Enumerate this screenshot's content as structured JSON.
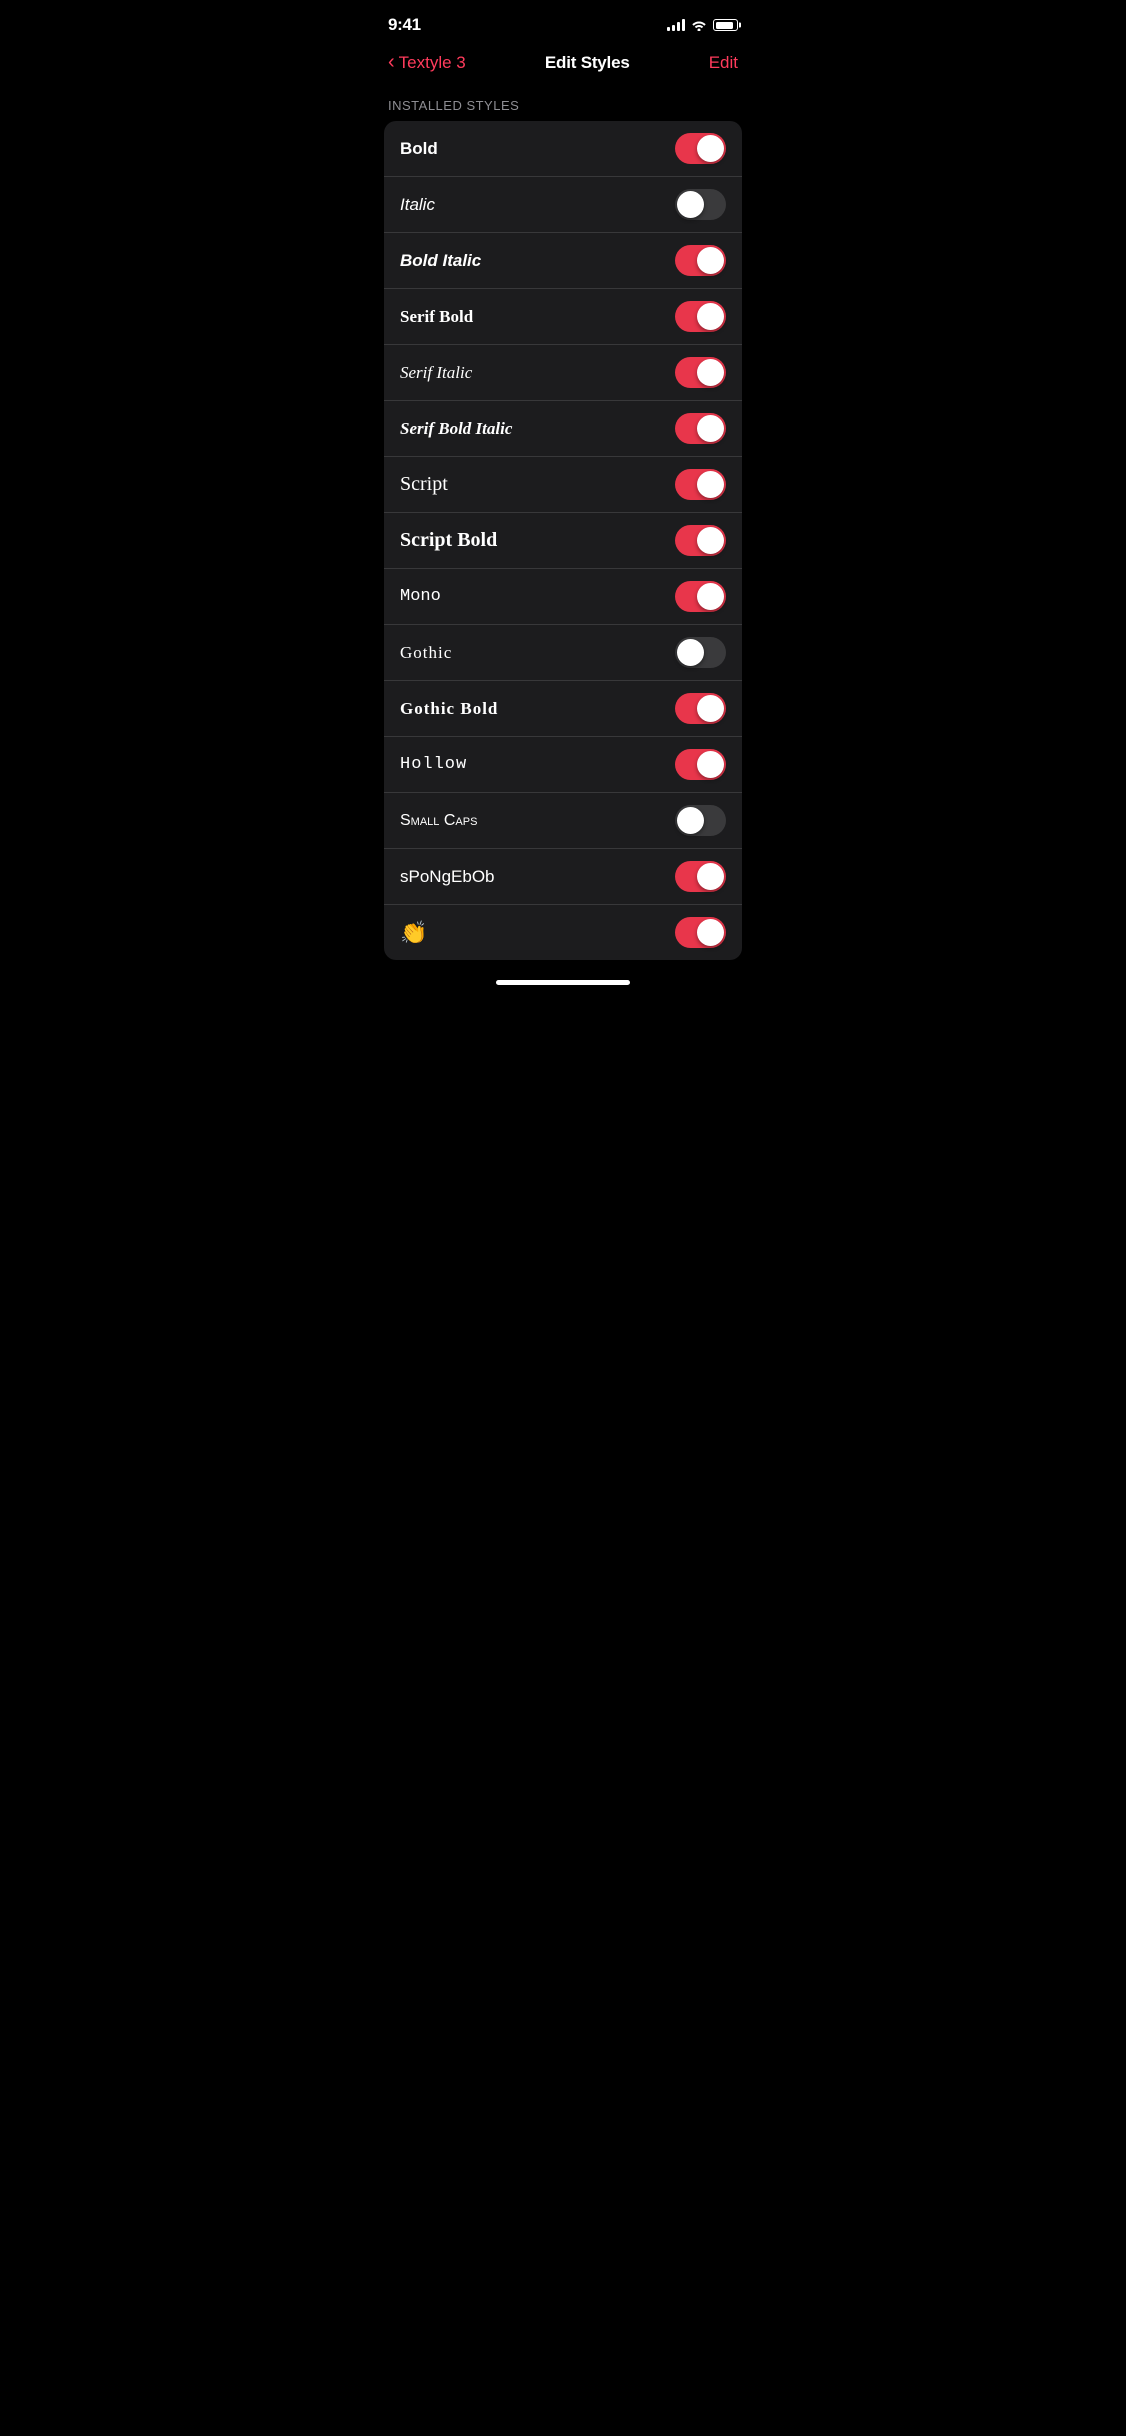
{
  "statusBar": {
    "time": "9:41",
    "signal": 4,
    "wifi": true,
    "battery": 85
  },
  "nav": {
    "backLabel": "Textyle 3",
    "title": "Edit Styles",
    "editLabel": "Edit"
  },
  "sectionHeader": "INSTALLED STYLES",
  "styles": [
    {
      "id": "bold",
      "label": "Bold",
      "fontClass": "font-bold",
      "enabled": true
    },
    {
      "id": "italic",
      "label": "Italic",
      "fontClass": "font-italic",
      "enabled": false
    },
    {
      "id": "bold-italic",
      "label": "Bold Italic",
      "fontClass": "font-bold-italic",
      "enabled": true
    },
    {
      "id": "serif-bold",
      "label": "Serif Bold",
      "fontClass": "font-serif",
      "enabled": true
    },
    {
      "id": "serif-italic",
      "label": "Serif Italic",
      "fontClass": "font-serif-italic",
      "enabled": true
    },
    {
      "id": "serif-bold-italic",
      "label": "Serif Bold Italic",
      "fontClass": "font-serif-bold-italic",
      "enabled": true
    },
    {
      "id": "script",
      "label": "Script",
      "fontClass": "font-script",
      "enabled": true
    },
    {
      "id": "script-bold",
      "label": "Script Bold",
      "fontClass": "font-script-bold",
      "enabled": true
    },
    {
      "id": "mono",
      "label": "Mono",
      "fontClass": "font-mono",
      "enabled": true
    },
    {
      "id": "gothic",
      "label": "Gothic",
      "fontClass": "font-gothic",
      "enabled": false
    },
    {
      "id": "gothic-bold",
      "label": "Gothic Bold",
      "fontClass": "font-gothic-bold",
      "enabled": true
    },
    {
      "id": "hollow",
      "label": "Hollow",
      "fontClass": "font-hollow",
      "enabled": true
    },
    {
      "id": "small-caps",
      "label": "Small Caps",
      "fontClass": "font-small-caps",
      "enabled": false
    },
    {
      "id": "spongee",
      "label": "sPoNgEbOb",
      "fontClass": "font-sponge",
      "enabled": true
    },
    {
      "id": "emoji",
      "label": "👏",
      "fontClass": "font-emoji",
      "enabled": true
    }
  ]
}
